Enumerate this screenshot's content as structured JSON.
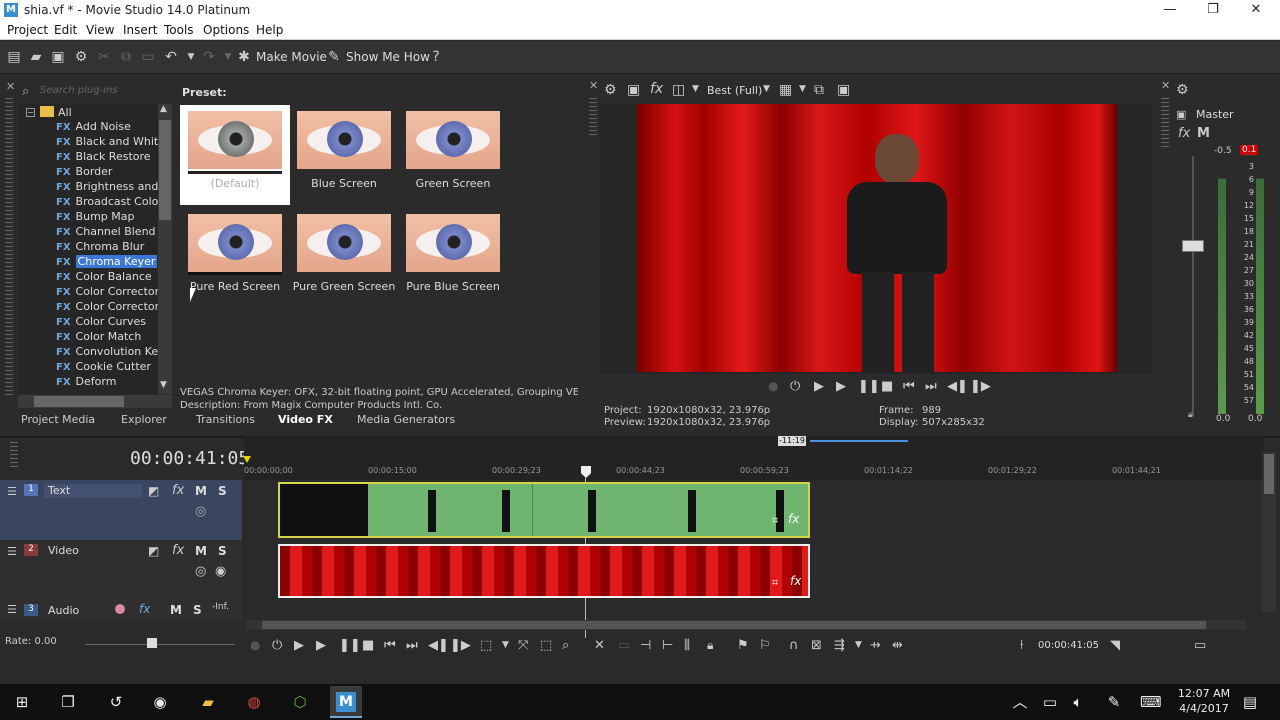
{
  "window": {
    "title": "shia.vf * - Movie Studio 14.0 Platinum",
    "icon_letter": "M"
  },
  "menu": [
    "Project",
    "Edit",
    "View",
    "Insert",
    "Tools",
    "Options",
    "Help"
  ],
  "toolbar": {
    "make_movie": "Make Movie",
    "show_me_how": "Show Me How"
  },
  "plugins": {
    "search_placeholder": "Search plug-ins",
    "root": "All",
    "items": [
      "Add Noise",
      "Black and White",
      "Black Restore",
      "Border",
      "Brightness and Co",
      "Broadcast Colors",
      "Bump Map",
      "Channel Blend",
      "Chroma Blur",
      "Chroma Keyer",
      "Color Balance",
      "Color Corrector",
      "Color Corrector (S",
      "Color Curves",
      "Color Match",
      "Convolution Kerne",
      "Cookie Cutter",
      "Deform"
    ],
    "selected": "Chroma Keyer",
    "fx_tag": "FX"
  },
  "presets": {
    "heading": "Preset:",
    "items": [
      "(Default)",
      "Blue Screen",
      "Green Screen",
      "Pure Red Screen",
      "Pure Green Screen",
      "Pure Blue Screen"
    ],
    "info_line1": "VEGAS Chroma Keyer: OFX, 32-bit floating point, GPU Accelerated, Grouping VEGAS\\Util",
    "info_line2": "Description: From Magix Computer Products Intl. Co."
  },
  "tabs": [
    "Project Media",
    "Explorer",
    "Transitions",
    "Video FX",
    "Media Generators"
  ],
  "active_tab": "Video FX",
  "preview": {
    "quality": "Best (Full)",
    "project_label": "Project:",
    "project_value": "1920x1080x32, 23.976p",
    "preview_label": "Preview:",
    "preview_value": "1920x1080x32, 23.976p",
    "frame_label": "Frame:",
    "frame_value": "989",
    "display_label": "Display:",
    "display_value": "507x285x32"
  },
  "mixer": {
    "master": "Master",
    "peak_left": "-0.5",
    "peak_right": "0.1",
    "scale": [
      "3",
      "6",
      "9",
      "12",
      "15",
      "18",
      "21",
      "24",
      "27",
      "30",
      "33",
      "36",
      "39",
      "42",
      "45",
      "48",
      "51",
      "54",
      "57"
    ],
    "level_left": "0.0",
    "level_right": "0.0"
  },
  "timeline": {
    "timecode": "00:00:41:05",
    "cursor_label": "-11:19",
    "ruler": [
      "00:00:00;00",
      "00:00:15;00",
      "00:00:29;23",
      "00:00:44;23",
      "00:00:59;23",
      "00:01:14;22",
      "00:01:29;22",
      "00:01:44;21"
    ],
    "tracks": [
      {
        "num": "1",
        "name": "Text"
      },
      {
        "num": "2",
        "name": "Video"
      },
      {
        "num": "3",
        "name": "Audio"
      }
    ],
    "rate": "Rate: 0.00",
    "bottom_time": "00:00:41:05",
    "audio_inf": "-Inf."
  },
  "taskbar": {
    "time": "12:07 AM",
    "date": "4/4/2017"
  },
  "colors": {
    "accent": "#3b77d9",
    "peak": "#cc0000"
  }
}
